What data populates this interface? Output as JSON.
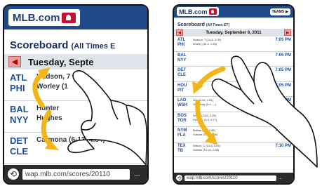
{
  "left": {
    "logo": "MLB.com",
    "scoreboard_title": "Scoreboard",
    "scoreboard_sub": "(All Times E",
    "date": "Tuesday, Septe",
    "games": [
      {
        "teams": [
          "ATL",
          "PHI"
        ],
        "pitchers": [
          "Hudson, 7",
          "Worley (1"
        ]
      },
      {
        "teams": [
          "BAL",
          "NYY"
        ],
        "pitchers": [
          "Hunter",
          "Hughes"
        ]
      },
      {
        "teams": [
          "DET",
          "CLE"
        ],
        "pitchers": [
          "",
          "Carmona (6-13, 4.84)"
        ]
      }
    ],
    "url": "wap.mlb.com/scores/20110",
    "dots": "..."
  },
  "right": {
    "logo": "MLB.com",
    "teams_button": "TEAMS",
    "scoreboard_title": "Scoreboard",
    "scoreboard_sub": "(All Times ET)",
    "date": "Tuesday, September 6, 2011",
    "games": [
      {
        "teams": [
          "ATL",
          "PHI"
        ],
        "pitchers": [
          "Hudson, T (14-8, 3.05)",
          "Worley (10-2, 2.85)"
        ],
        "time": "7:05 PM"
      },
      {
        "teams": [
          "BAL",
          "NYY"
        ],
        "pitchers": [
          "",
          ""
        ],
        "time": "7:05 PM"
      },
      {
        "teams": [
          "DET",
          "CLE"
        ],
        "pitchers": [
          "",
          ""
        ],
        "time": "7:05 PM"
      },
      {
        "teams": [
          "HOU",
          "PIT"
        ],
        "pitchers": [
          "",
          "Lincoln"
        ],
        "time": "7:05 PM"
      },
      {
        "teams": [
          "LAD",
          "WSH"
        ],
        "pitchers": [
          "Lilly (8-15, 4.09)",
          "Strasburg (0-0, ---)"
        ],
        "time": "7:05 PM"
      },
      {
        "teams": [
          "BOS",
          "TOR"
        ],
        "pitchers": [
          "Lester (14-6, 3.05)",
          "Perez, L (0-0, 6.77)"
        ],
        "time": "7:07 PM"
      },
      {
        "teams": [
          "NYM",
          "FLA"
        ],
        "pitchers": [
          "Batista (4-0, 2.95)",
          "Volstad (5-12, 4.98)"
        ],
        "time": "7:10 PM"
      },
      {
        "teams": [
          "TEX",
          "TB"
        ],
        "pitchers": [
          "Wilson, C (14-6, 3.05)",
          "Shields (14-10, 2.88)"
        ],
        "time": "7:10 PM"
      }
    ],
    "url": "wap.mlb.com/scores/20110",
    "dots": "..."
  },
  "icons": {
    "prev": "◀",
    "next": "▶",
    "refresh": "⟲"
  },
  "colors": {
    "header": "#1f4a8a",
    "team_text": "#1f4fa0",
    "logo_red": "#c8102e",
    "gesture_arrow": "#f2b619"
  }
}
